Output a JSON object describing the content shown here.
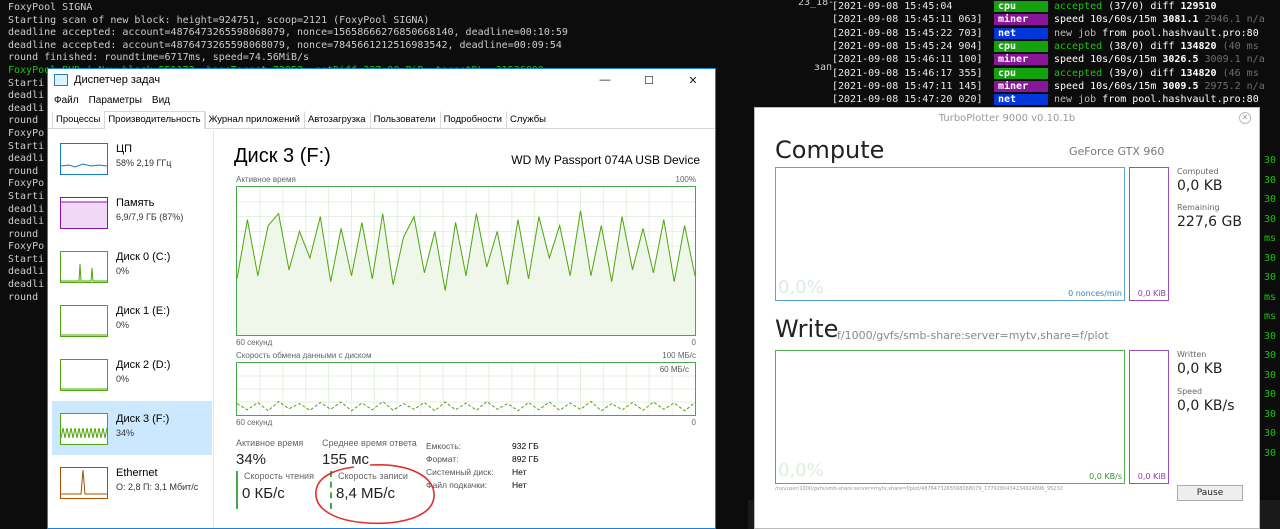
{
  "left_terminal": {
    "lines": [
      "FoxyPool SIGNA",
      "Starting scan of new block: height=924751, scoop=2121 (FoxyPool SIGNA)",
      "deadline accepted: account=4876473265598068079, nonce=15658666276850668140, deadline=00:10:59",
      "deadline accepted: account=4876473265598068079, nonce=7845661212516983542, deadline=00:09:54",
      "round finished: roundtime=6717ms, speed=74.56MiB/s",
      "FoxyPool BHD | New block 551172, baseTarget 72952, netDiff 327.00 PiB, targetDL: 31536000",
      "Starti",
      "deadli",
      "deadli",
      "round",
      "FoxyPo",
      "Starti",
      "deadli",
      "round",
      "FoxyPo",
      "Starti",
      "deadli",
      "deadli",
      "round",
      "FoxyPo",
      "Starti",
      "deadli",
      "deadli",
      "round"
    ]
  },
  "right_terminal": {
    "header_fragment": "23_18-",
    "side_left_text": "зап",
    "rows": [
      {
        "ts": "[2021-09-08 15:45:04 ",
        "ms": "",
        "tag": "cpu",
        "parts": [
          [
            "accepted",
            "accepted"
          ],
          [
            "",
            " (37/0) diff "
          ],
          [
            "bold",
            "129510"
          ]
        ]
      },
      {
        "ts": "[2021-09-08 15:45:11 ",
        "ms": "063]",
        "tag": "miner",
        "parts": [
          [
            "",
            "speed 10s/60s/15m "
          ],
          [
            "bold",
            "3081.1"
          ],
          [
            "muted",
            " 2946.1 n/a"
          ]
        ]
      },
      {
        "ts": "[2021-09-08 15:45:22 ",
        "ms": "703]",
        "tag": "net",
        "parts": [
          [
            "newjob",
            "new job"
          ],
          [
            "",
            " from pool.hashvault.pro:80"
          ]
        ]
      },
      {
        "ts": "[2021-09-08 15:45:24 ",
        "ms": "904]",
        "tag": "cpu",
        "parts": [
          [
            "accepted",
            "accepted"
          ],
          [
            "",
            " (38/0) diff "
          ],
          [
            "bold",
            "134820"
          ],
          [
            "muted",
            " (40 ms"
          ]
        ]
      },
      {
        "ts": "[2021-09-08 15:46:11 ",
        "ms": "100]",
        "tag": "miner",
        "parts": [
          [
            "",
            "speed 10s/60s/15m "
          ],
          [
            "bold",
            "3026.5"
          ],
          [
            "muted",
            " 3009.1 n/a"
          ]
        ]
      },
      {
        "ts": "[2021-09-08 15:46:17 ",
        "ms": "355]",
        "tag": "cpu",
        "parts": [
          [
            "accepted",
            "accepted"
          ],
          [
            "",
            " (39/0) diff "
          ],
          [
            "bold",
            "134820"
          ],
          [
            "muted",
            " (46 ms"
          ]
        ]
      },
      {
        "ts": "[2021-09-08 15:47:11 ",
        "ms": "145]",
        "tag": "miner",
        "parts": [
          [
            "",
            "speed 10s/60s/15m "
          ],
          [
            "bold",
            "3009.5"
          ],
          [
            "muted",
            " 2975.2 n/a"
          ]
        ]
      },
      {
        "ts": "[2021-09-08 15:47:20 ",
        "ms": "020]",
        "tag": "net",
        "parts": [
          [
            "newjob",
            "new job"
          ],
          [
            "",
            " from pool.hashvault.pro:80"
          ]
        ]
      },
      {
        "ts": "[2021-09-08 15:47:22 ",
        "ms": "883]",
        "tag": "net",
        "parts": [
          [
            "newjob",
            "new job"
          ],
          [
            "",
            " from pool.hashvault.pro:80"
          ]
        ]
      }
    ],
    "side_digits": [
      "30",
      "30",
      "30",
      "30",
      "ms",
      "30",
      "30",
      "ms",
      "ms",
      "30",
      "30",
      "30",
      "30",
      "30",
      "30",
      "30"
    ]
  },
  "taskmgr": {
    "title": "Диспетчер задач",
    "window_buttons": {
      "minimize": "—",
      "maximize": "☐",
      "close": "✕"
    },
    "menu": [
      "Файл",
      "Параметры",
      "Вид"
    ],
    "tabs": [
      "Процессы",
      "Производительность",
      "Журнал приложений",
      "Автозагрузка",
      "Пользователи",
      "Подробности",
      "Службы"
    ],
    "active_tab": 1,
    "sidebar": [
      {
        "name": "ЦП",
        "sub": "58% 2,19 ГГц",
        "color": "#117dbb"
      },
      {
        "name": "Память",
        "sub": "6,9/7,9 ГБ (87%)",
        "color": "#8b12ae"
      },
      {
        "name": "Диск 0 (C:)",
        "sub": "0%",
        "color": "#4da60c"
      },
      {
        "name": "Диск 1 (E:)",
        "sub": "0%",
        "color": "#4da60c"
      },
      {
        "name": "Диск 2 (D:)",
        "sub": "0%",
        "color": "#4da60c"
      },
      {
        "name": "Диск 3 (F:)",
        "sub": "34%",
        "color": "#4da60c"
      },
      {
        "name": "Ethernet",
        "sub": "О: 2,8 П: 3,1 Мбит/с",
        "color": "#a74f01"
      }
    ],
    "selected_item": 5,
    "main": {
      "title": "Диск 3 (F:)",
      "model": "WD My Passport 074A USB Device",
      "chart1": {
        "label": "Активное время",
        "max": "100%",
        "xleft": "60 секунд",
        "xright": "0"
      },
      "chart2": {
        "label": "Скорость обмена данными с диском",
        "max": "100 МБ/с",
        "inner_max": "60 МБ/с",
        "xleft": "60 секунд",
        "xright": "0"
      },
      "stats": {
        "active_label": "Активное время",
        "active_value": "34%",
        "avg_label": "Среднее время ответа",
        "avg_value": "155 мс",
        "read_label": "Скорость чтения",
        "read_value": "0 КБ/с",
        "write_label": "Скорость записи",
        "write_value": "8,4 МБ/с"
      },
      "props": [
        {
          "key": "Емкость:",
          "val": "932 ГБ"
        },
        {
          "key": "Формат:",
          "val": "892 ГБ"
        },
        {
          "key": "Системный диск:",
          "val": "Нет"
        },
        {
          "key": "Файл подкачки:",
          "val": "Нет"
        }
      ]
    },
    "chart_data": {
      "active_time_percent": [
        38,
        78,
        40,
        74,
        82,
        44,
        70,
        52,
        80,
        36,
        72,
        40,
        76,
        38,
        82,
        34,
        66,
        80,
        42,
        70,
        30,
        76,
        40,
        82,
        46,
        70,
        34,
        78,
        38,
        80,
        52,
        74,
        40,
        84,
        40,
        74,
        36,
        80,
        44,
        72,
        42,
        78,
        36,
        74,
        40
      ],
      "transfer_write_percent": [
        22,
        10,
        24,
        8,
        26,
        12,
        22,
        9,
        24,
        11,
        25,
        8,
        23,
        10,
        26,
        9,
        22,
        11,
        24,
        8,
        25,
        10,
        23,
        9,
        26,
        11,
        22,
        8,
        24,
        10,
        25,
        9,
        23,
        11,
        26,
        8,
        22,
        10,
        24,
        9,
        25,
        11,
        23,
        8,
        24
      ]
    }
  },
  "plotter": {
    "title": "TurboPlotter 9000 v0.10.1b",
    "close_icon": "✕",
    "compute": {
      "heading": "Compute",
      "gpu": "GeForce GTX 960",
      "zero": "0,0%",
      "nonces": "0 nonces/min",
      "bar_value": "0,0 KiB",
      "computed_label": "Computed",
      "computed_value": "0,0 KB",
      "remaining_label": "Remaining",
      "remaining_value": "227,6 GB"
    },
    "write": {
      "heading": "Write",
      "path": "f/1000/gvfs/smb-share:server=mytv,share=f/plot",
      "zero": "0,0%",
      "rate": "0,0 KB/s",
      "bar_value": "0,0 KiB",
      "written_label": "Written",
      "written_value": "0,0 KB",
      "speed_label": "Speed",
      "speed_value": "0,0 KB/s"
    },
    "tiny_path": "/run/user/1000/gvfs/smb-share:server=mytv,share=f/plot/4876473265598068079_1779280434234924896_95232",
    "pause_label": "Pause"
  },
  "colors": {
    "accent_blue": "#1883d7",
    "disk_green": "#4aa64a",
    "cpu_blue": "#117dbb",
    "mem_purple": "#8b12ae",
    "eth_brown": "#a74f01",
    "annotation_red": "#e03030"
  }
}
